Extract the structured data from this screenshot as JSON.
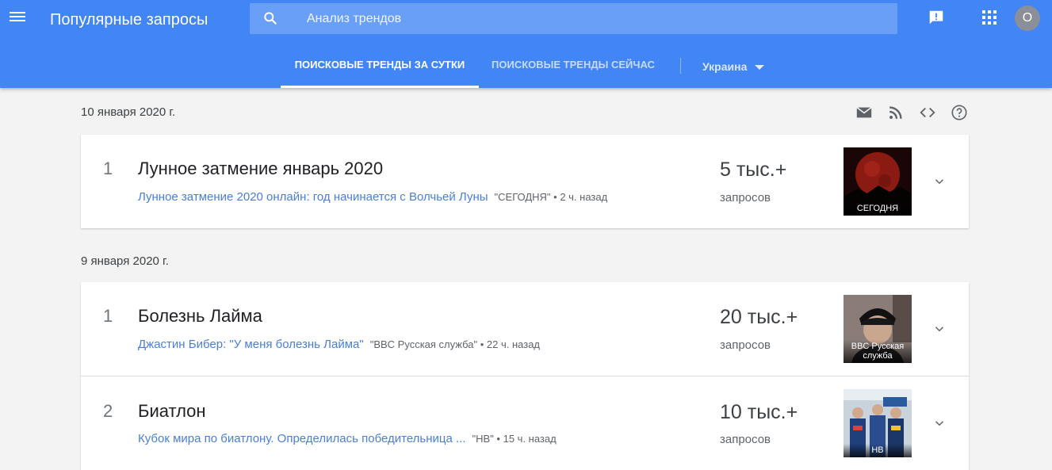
{
  "header": {
    "title": "Популярные запросы",
    "search_placeholder": "Анализ трендов"
  },
  "tabs": [
    {
      "label": "Поисковые тренды за сутки",
      "active": true
    },
    {
      "label": "Поисковые тренды сейчас",
      "active": false
    }
  ],
  "region": "Украина",
  "avatar_letter": "O",
  "colors": {
    "appbar": "#4285f4",
    "link": "#4a7fd4"
  },
  "icons": [
    "menu-icon",
    "search-icon",
    "feedback-icon",
    "apps-icon",
    "email-icon",
    "rss-icon",
    "embed-icon",
    "help-icon",
    "chevron-down-icon"
  ],
  "days": [
    {
      "date": "10 января 2020 г.",
      "trends": [
        {
          "rank": "1",
          "term": "Лунное затмение январь 2020",
          "article_title": "Лунное затмение 2020 онлайн: год начинается с Волчьей Луны",
          "source": "\"СЕГОДНЯ\"",
          "time": "2 ч. назад",
          "count": "5 тыс.+",
          "count_label": "запросов",
          "thumb_caption": "СЕГОДНЯ"
        }
      ]
    },
    {
      "date": "9 января 2020 г.",
      "trends": [
        {
          "rank": "1",
          "term": "Болезнь Лайма",
          "article_title": "Джастин Бибер: \"У меня болезнь Лайма\"",
          "source": "\"BBC Русская служба\"",
          "time": "22 ч. назад",
          "count": "20 тыс.+",
          "count_label": "запросов",
          "thumb_caption": "BBC Русская служба"
        },
        {
          "rank": "2",
          "term": "Биатлон",
          "article_title": "Кубок мира по биатлону. Определилась победительница ...",
          "source": "\"НВ\"",
          "time": "15 ч. назад",
          "count": "10 тыс.+",
          "count_label": "запросов",
          "thumb_caption": "НВ"
        }
      ]
    }
  ]
}
